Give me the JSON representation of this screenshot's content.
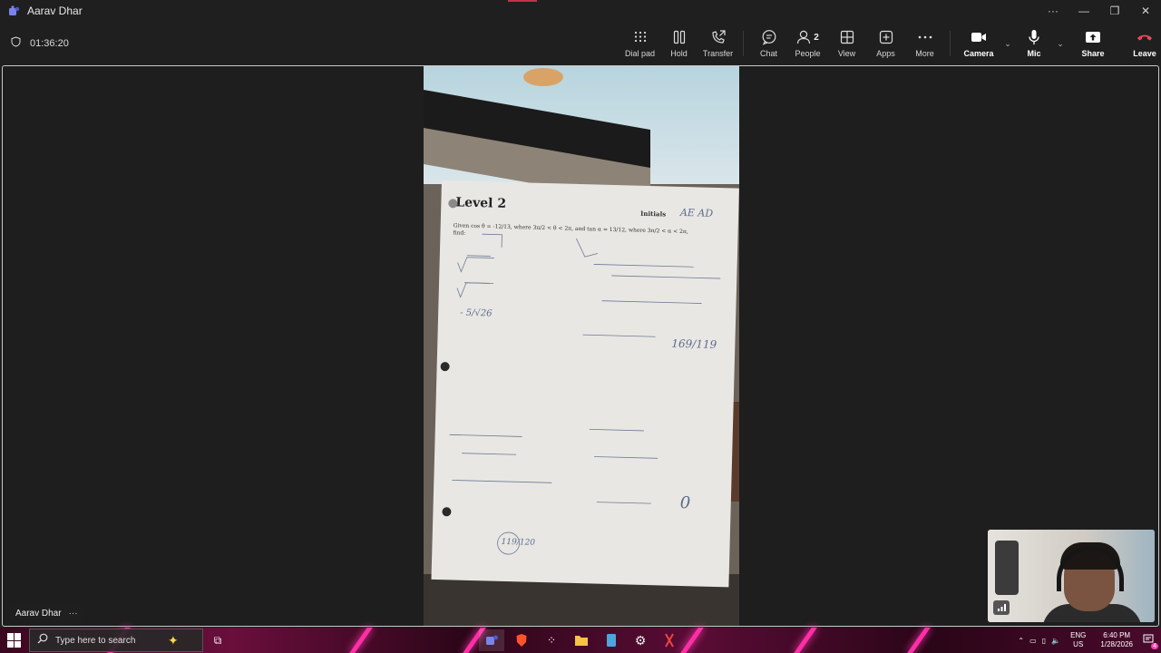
{
  "window": {
    "title": "Aarav Dhar",
    "controls": [
      "more",
      "minimize",
      "restore",
      "close"
    ]
  },
  "call": {
    "timer": "01:36:20",
    "toolbar": [
      {
        "label": "Dial pad",
        "icon": "dialpad-icon"
      },
      {
        "label": "Hold",
        "icon": "hold-icon"
      },
      {
        "label": "Transfer",
        "icon": "transfer-icon"
      },
      {
        "label": "Chat",
        "icon": "chat-icon"
      },
      {
        "label": "People",
        "icon": "people-icon",
        "badge": "2"
      },
      {
        "label": "View",
        "icon": "view-icon"
      },
      {
        "label": "Apps",
        "icon": "apps-icon"
      },
      {
        "label": "More",
        "icon": "more-icon"
      },
      {
        "label": "Camera",
        "icon": "camera-icon"
      },
      {
        "label": "Mic",
        "icon": "mic-icon"
      },
      {
        "label": "Share",
        "icon": "share-icon"
      },
      {
        "label": "Leave",
        "icon": "leave-icon"
      }
    ]
  },
  "stage": {
    "participant_name": "Aarav Dhar",
    "worksheet": {
      "heading": "Level 2",
      "initials_label": "Initials",
      "initials_value": "AE AD",
      "prompt": "Given cos θ = -12/13, where 3π/2 < θ < 2π, and tan α = 13/12, where 3π/2 < α < 2π, find:",
      "answer_a": "- 5/√26",
      "answer_b": "169/119",
      "answer_c": "119/120",
      "answer_d": "0"
    }
  },
  "taskbar": {
    "search_placeholder": "Type here to search",
    "language_line1": "ENG",
    "language_line2": "US",
    "time": "6:40 PM",
    "date": "1/28/2026",
    "notification_count": "4"
  },
  "colors": {
    "leave": "#c4314b",
    "taskbar_neon": "#ff2ea6",
    "accent": "#6264a7"
  }
}
